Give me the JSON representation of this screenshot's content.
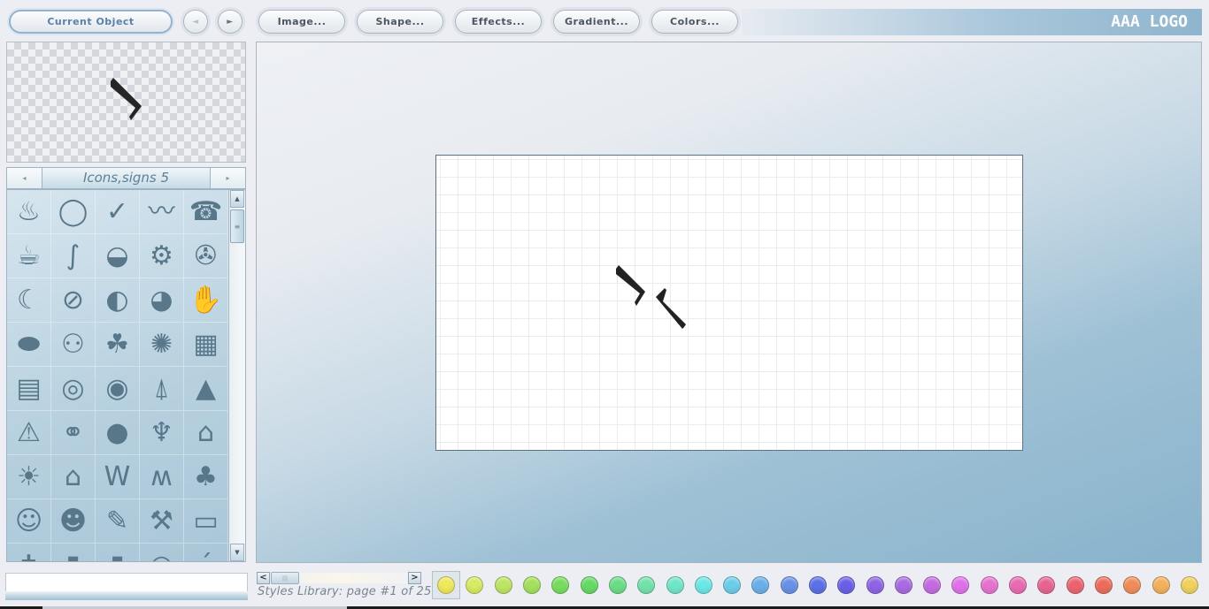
{
  "toolbar": {
    "current_object": "Current Object",
    "prev": "◄",
    "next": "►",
    "image": "Image...",
    "shape": "Shape...",
    "effects": "Effects...",
    "gradient": "Gradient...",
    "colors": "Colors..."
  },
  "logo": "AAA LOGO",
  "library": {
    "category": "Icons,signs 5",
    "prev_arrow": "◂",
    "next_arrow": "▸",
    "icons": [
      {
        "name": "steaming-cups",
        "glyph": "♨"
      },
      {
        "name": "swirl-ring",
        "glyph": "◯"
      },
      {
        "name": "swoosh",
        "glyph": "✓"
      },
      {
        "name": "wave",
        "glyph": "〰"
      },
      {
        "name": "telephone",
        "glyph": "☎"
      },
      {
        "name": "hot-coffee",
        "glyph": "☕"
      },
      {
        "name": "s-curve",
        "glyph": "∫"
      },
      {
        "name": "cup",
        "glyph": "◒"
      },
      {
        "name": "gears",
        "glyph": "⚙"
      },
      {
        "name": "swirl-circle",
        "glyph": "✇"
      },
      {
        "name": "wave-curl",
        "glyph": "☾"
      },
      {
        "name": "no-smoking",
        "glyph": "⊘"
      },
      {
        "name": "half-globe",
        "glyph": "◐"
      },
      {
        "name": "earth",
        "glyph": "◕"
      },
      {
        "name": "hand-print",
        "glyph": "✋"
      },
      {
        "name": "turtle",
        "glyph": "⬬"
      },
      {
        "name": "people",
        "glyph": "⚇"
      },
      {
        "name": "clover",
        "glyph": "☘"
      },
      {
        "name": "splash",
        "glyph": "✺"
      },
      {
        "name": "brick-wall",
        "glyph": "▦"
      },
      {
        "name": "calculator",
        "glyph": "▤"
      },
      {
        "name": "spiral-1",
        "glyph": "◎"
      },
      {
        "name": "spiral-2",
        "glyph": "◉"
      },
      {
        "name": "xmas-tree-outline",
        "glyph": "⍋"
      },
      {
        "name": "xmas-tree",
        "glyph": "▲"
      },
      {
        "name": "fire-warning",
        "glyph": "⚠"
      },
      {
        "name": "handshake",
        "glyph": "⚭"
      },
      {
        "name": "fire-circle",
        "glyph": "●"
      },
      {
        "name": "flames",
        "glyph": "♆"
      },
      {
        "name": "schoolhouse",
        "glyph": "⌂"
      },
      {
        "name": "sun-house",
        "glyph": "☀"
      },
      {
        "name": "house",
        "glyph": "⌂"
      },
      {
        "name": "wonder-logo",
        "glyph": "W"
      },
      {
        "name": "w-wing",
        "glyph": "ʍ"
      },
      {
        "name": "palm-tree",
        "glyph": "♣"
      },
      {
        "name": "smiley-girl",
        "glyph": "☺"
      },
      {
        "name": "ball-flowers",
        "glyph": "☻"
      },
      {
        "name": "paint-brush",
        "glyph": "✎"
      },
      {
        "name": "scraper",
        "glyph": "⚒"
      },
      {
        "name": "bus",
        "glyph": "▭"
      },
      {
        "name": "cross-item",
        "glyph": "✝"
      },
      {
        "name": "glass",
        "glyph": "▮"
      },
      {
        "name": "bottle",
        "glyph": "▮"
      },
      {
        "name": "oval",
        "glyph": "◠"
      },
      {
        "name": "tick",
        "glyph": "ˊ"
      }
    ]
  },
  "scroll": {
    "up": "▲",
    "down": "▼",
    "grip": "≡",
    "left": "<",
    "right": ">",
    "hgrip": "|||"
  },
  "bottom": {
    "input_value": "",
    "styles_label": "Styles Library: page #1 of 25"
  },
  "swatches": [
    "#efe85a",
    "#d6ea62",
    "#bde462",
    "#a2e05e",
    "#77dc5e",
    "#66d964",
    "#6bdc86",
    "#72e2aa",
    "#6fe6c9",
    "#6be7e6",
    "#6ccde9",
    "#6aafe8",
    "#6790e6",
    "#5b6fe6",
    "#6a60e6",
    "#8e63e6",
    "#a96ae2",
    "#c46be0",
    "#e070ea",
    "#e672cf",
    "#e86ab0",
    "#e86490",
    "#ea6470",
    "#ec6c5a",
    "#ef8c58",
    "#f1b05c",
    "#f1d05e"
  ]
}
